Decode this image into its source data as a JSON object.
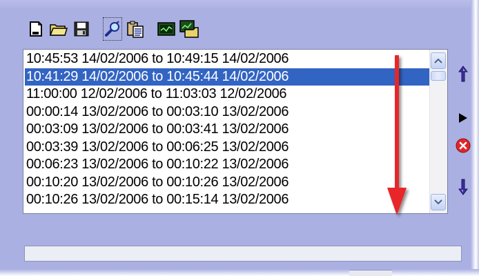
{
  "toolbar": {
    "buttons": [
      {
        "icon": "new-document-icon"
      },
      {
        "icon": "open-folder-icon"
      },
      {
        "icon": "save-disk-icon"
      },
      {
        "icon": "search-tool-icon",
        "focused": true
      },
      {
        "icon": "clipboard-paste-icon"
      },
      {
        "icon": "graph-view-icon"
      },
      {
        "icon": "graph-export-icon"
      }
    ]
  },
  "session_list": {
    "items": [
      "10:45:53 14/02/2006 to 10:49:15 14/02/2006",
      "10:41:29 14/02/2006 to 10:45:44 14/02/2006",
      "11:00:00 12/02/2006 to 11:03:03 12/02/2006",
      "00:00:14 13/02/2006 to 00:03:10 13/02/2006",
      "00:03:09 13/02/2006 to 00:03:41 13/02/2006",
      "00:03:39 13/02/2006 to 00:06:25 13/02/2006",
      "00:06:23 13/02/2006 to 00:10:22 13/02/2006",
      "00:10:20 13/02/2006 to 00:10:26 13/02/2006",
      "00:10:26 13/02/2006 to 00:15:14 13/02/2006"
    ],
    "selected_index": 1
  },
  "side_buttons": [
    {
      "icon": "move-up-icon"
    },
    {
      "icon": "play-icon"
    },
    {
      "icon": "delete-icon"
    },
    {
      "icon": "move-down-icon"
    }
  ],
  "progress": {
    "value": 0
  },
  "colors": {
    "panel_background": "#aab0e2",
    "selection": "#3264c3",
    "annotation_arrow": "#e8262a"
  }
}
